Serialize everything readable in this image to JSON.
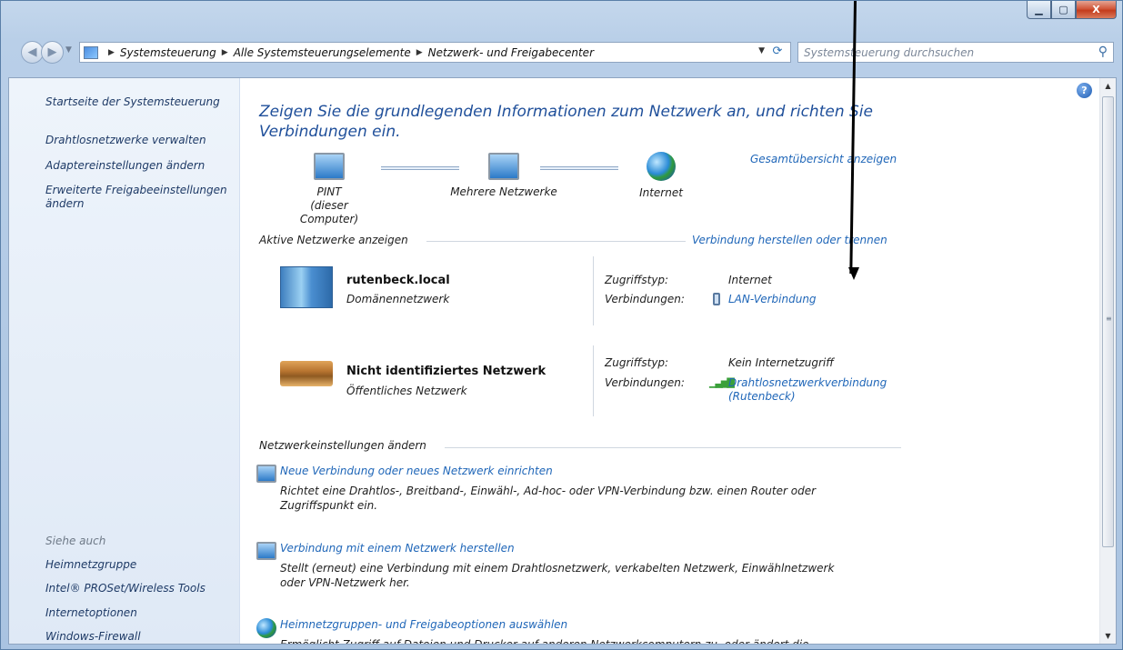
{
  "window": {
    "minimize_glyph": "▁",
    "maximize_glyph": "▢",
    "close_glyph": "X"
  },
  "address": {
    "crumbs": [
      "Systemsteuerung",
      "Alle Systemsteuerungselemente",
      "Netzwerk- und Freigabecenter"
    ],
    "search_placeholder": "Systemsteuerung durchsuchen"
  },
  "sidebar": {
    "items": [
      "Startseite der Systemsteuerung",
      "Drahtlosnetzwerke verwalten",
      "Adaptereinstellungen ändern",
      "Erweiterte Freigabeeinstellungen ändern"
    ],
    "see_also_header": "Siehe auch",
    "see_also": [
      "Heimnetzgruppe",
      "Intel® PROSet/Wireless Tools",
      "Internetoptionen",
      "Windows-Firewall"
    ]
  },
  "main": {
    "title": "Zeigen Sie die grundlegenden Informationen zum Netzwerk an, und richten Sie Verbindungen ein.",
    "overview_link": "Gesamtübersicht anzeigen",
    "map": {
      "computer_name": "PINT",
      "computer_sub": "(dieser Computer)",
      "middle": "Mehrere Netzwerke",
      "internet": "Internet"
    },
    "active_networks_label": "Aktive Netzwerke anzeigen",
    "connect_disconnect_link": "Verbindung herstellen oder trennen",
    "networks": [
      {
        "name": "rutenbeck.local",
        "type": "Domänennetzwerk",
        "access_label": "Zugriffstyp:",
        "access_value": "Internet",
        "conn_label": "Verbindungen:",
        "conn_value": "LAN-Verbindung"
      },
      {
        "name": "Nicht identifiziertes Netzwerk",
        "type": "Öffentliches Netzwerk",
        "access_label": "Zugriffstyp:",
        "access_value": "Kein Internetzugriff",
        "conn_label": "Verbindungen:",
        "conn_value_line1": "Drahtlosnetzwerkverbindung",
        "conn_value_line2": "(Rutenbeck)"
      }
    ],
    "change_settings_label": "Netzwerkeinstellungen ändern",
    "tasks": [
      {
        "link": "Neue Verbindung oder neues Netzwerk einrichten",
        "desc": "Richtet eine Drahtlos-, Breitband-, Einwähl-, Ad-hoc- oder VPN-Verbindung bzw. einen Router oder Zugriffspunkt ein."
      },
      {
        "link": "Verbindung mit einem Netzwerk herstellen",
        "desc": "Stellt (erneut) eine Verbindung mit einem Drahtlosnetzwerk, verkabelten Netzwerk, Einwählnetzwerk oder VPN-Netzwerk her."
      },
      {
        "link": "Heimnetzgruppen- und Freigabeoptionen auswählen",
        "desc": "Ermöglicht Zugriff auf Dateien und Drucker auf anderen Netzwerkcomputern zu, oder ändert die"
      }
    ]
  },
  "help_glyph": "?"
}
